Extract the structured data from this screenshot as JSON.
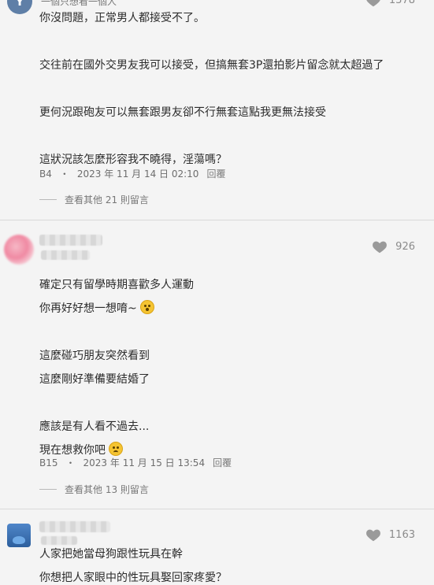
{
  "comments": [
    {
      "avatar_letter": "Y",
      "header_partial": "一個只想看一個人",
      "likes": "1378",
      "lines": [
        "你沒問題，正常男人都接受不了。",
        "",
        "交往前在國外交男友我可以接受，但搞無套3P還拍影片留念就太超過了",
        "",
        "更何況跟砲友可以無套跟男友卻不行無套這點我更無法接受",
        "",
        "這狀況該怎麼形容我不曉得，淫蕩嗎？"
      ],
      "floor": "B4",
      "date": "2023 年 11 月 14 日 02:10",
      "reply_label": "回覆",
      "more_label": "查看其他 21 則留言"
    },
    {
      "likes": "926",
      "lines": [
        "確定只有留學時期喜歡多人運動",
        "你再好好想一想唷~",
        "",
        "這麼碰巧朋友突然看到",
        "這麼剛好準備要結婚了",
        "",
        "應該是有人看不過去...",
        "現在想救你吧"
      ],
      "floor": "B15",
      "date": "2023 年 11 月 15 日 13:54",
      "reply_label": "回覆",
      "more_label": "查看其他 13 則留言"
    },
    {
      "likes": "1163",
      "lines": [
        "人家把她當母狗跟性玩具在幹",
        "你想把人家眼中的性玩具娶回家疼愛？"
      ]
    }
  ]
}
